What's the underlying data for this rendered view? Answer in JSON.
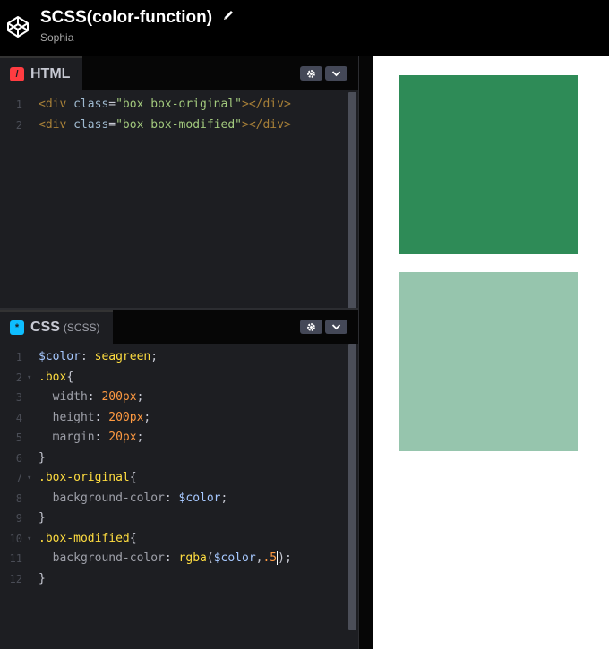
{
  "pen": {
    "title": "SCSS(color-function)",
    "author": "Sophia"
  },
  "html_panel": {
    "label": "HTML",
    "lines": [
      {
        "n": "1",
        "tokens": [
          {
            "t": "<div ",
            "c": "t-tag"
          },
          {
            "t": "class",
            "c": "t-attr"
          },
          {
            "t": "=",
            "c": "t-punc"
          },
          {
            "t": "\"box box-original\"",
            "c": "t-str"
          },
          {
            "t": "></div>",
            "c": "t-tag"
          }
        ]
      },
      {
        "n": "2",
        "tokens": [
          {
            "t": "<div ",
            "c": "t-tag"
          },
          {
            "t": "class",
            "c": "t-attr"
          },
          {
            "t": "=",
            "c": "t-punc"
          },
          {
            "t": "\"box box-modified\"",
            "c": "t-str"
          },
          {
            "t": "></div>",
            "c": "t-tag"
          }
        ]
      }
    ]
  },
  "css_panel": {
    "label": "CSS",
    "sublabel": "(SCSS)",
    "lines": [
      {
        "n": "1",
        "fold": false,
        "tokens": [
          {
            "t": "$color",
            "c": "t-var"
          },
          {
            "t": ": ",
            "c": "t-punc"
          },
          {
            "t": "seagreen",
            "c": "t-val"
          },
          {
            "t": ";",
            "c": "t-punc"
          }
        ]
      },
      {
        "n": "2",
        "fold": true,
        "tokens": [
          {
            "t": ".box",
            "c": "t-sel"
          },
          {
            "t": "{",
            "c": "t-punc"
          }
        ]
      },
      {
        "n": "3",
        "fold": false,
        "tokens": [
          {
            "t": "  width",
            "c": "t-prop"
          },
          {
            "t": ": ",
            "c": "t-punc"
          },
          {
            "t": "200px",
            "c": "t-num"
          },
          {
            "t": ";",
            "c": "t-punc"
          }
        ]
      },
      {
        "n": "4",
        "fold": false,
        "tokens": [
          {
            "t": "  height",
            "c": "t-prop"
          },
          {
            "t": ": ",
            "c": "t-punc"
          },
          {
            "t": "200px",
            "c": "t-num"
          },
          {
            "t": ";",
            "c": "t-punc"
          }
        ]
      },
      {
        "n": "5",
        "fold": false,
        "tokens": [
          {
            "t": "  margin",
            "c": "t-prop"
          },
          {
            "t": ": ",
            "c": "t-punc"
          },
          {
            "t": "20px",
            "c": "t-num"
          },
          {
            "t": ";",
            "c": "t-punc"
          }
        ]
      },
      {
        "n": "6",
        "fold": false,
        "tokens": [
          {
            "t": "}",
            "c": "t-punc"
          }
        ]
      },
      {
        "n": "7",
        "fold": true,
        "tokens": [
          {
            "t": ".box-original",
            "c": "t-sel"
          },
          {
            "t": "{",
            "c": "t-punc"
          }
        ]
      },
      {
        "n": "8",
        "fold": false,
        "tokens": [
          {
            "t": "  background-color",
            "c": "t-prop"
          },
          {
            "t": ": ",
            "c": "t-punc"
          },
          {
            "t": "$color",
            "c": "t-var"
          },
          {
            "t": ";",
            "c": "t-punc"
          }
        ]
      },
      {
        "n": "9",
        "fold": false,
        "tokens": [
          {
            "t": "}",
            "c": "t-punc"
          }
        ]
      },
      {
        "n": "10",
        "fold": true,
        "tokens": [
          {
            "t": ".box-modified",
            "c": "t-sel"
          },
          {
            "t": "{",
            "c": "t-punc"
          }
        ]
      },
      {
        "n": "11",
        "fold": false,
        "tokens": [
          {
            "t": "  background-color",
            "c": "t-prop"
          },
          {
            "t": ": ",
            "c": "t-punc"
          },
          {
            "t": "rgba",
            "c": "t-fn"
          },
          {
            "t": "(",
            "c": "t-punc"
          },
          {
            "t": "$color",
            "c": "t-var"
          },
          {
            "t": ",",
            "c": "t-punc"
          },
          {
            "t": ".5",
            "c": "t-num"
          },
          {
            "t": ")",
            "c": "t-punc cursor"
          },
          {
            "t": ";",
            "c": "t-punc"
          }
        ]
      },
      {
        "n": "12",
        "fold": false,
        "tokens": [
          {
            "t": "}",
            "c": "t-punc"
          }
        ]
      }
    ]
  },
  "colors": {
    "accent_html": "#ff3c41",
    "accent_css": "#0ebeff",
    "box_original": "#2e8b57",
    "box_modified": "#96c5ad"
  },
  "icons": {
    "logo": "codepen-logo-icon",
    "edit": "pencil-icon",
    "settings": "gear-icon",
    "collapse": "chevron-down-icon"
  }
}
